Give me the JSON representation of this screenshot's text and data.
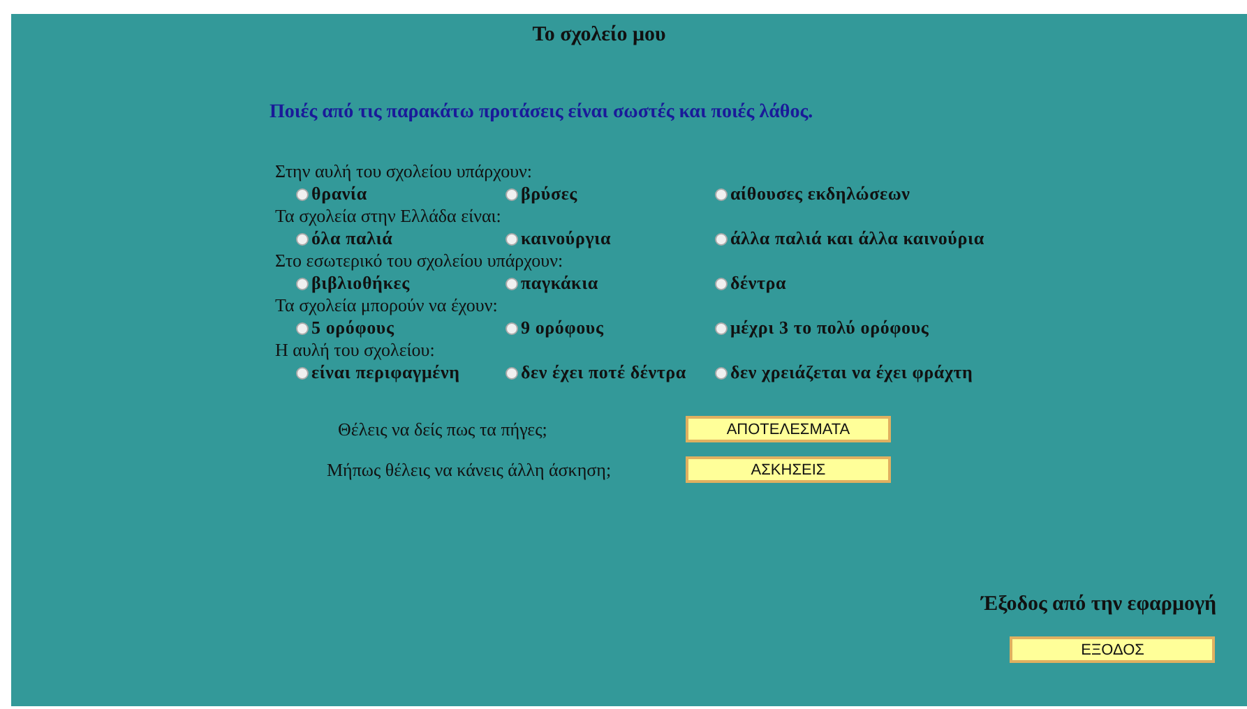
{
  "title": "Το σχολείο μου",
  "instruction": "Ποιές από τις παρακάτω προτάσεις είναι σωστές και ποιές λάθος.",
  "questions": [
    {
      "prompt": "Στην αυλή του σχολείου υπάρχουν:",
      "options": [
        {
          "label": "θρανία",
          "selected": false
        },
        {
          "label": "βρύσες",
          "selected": false
        },
        {
          "label": "αίθουσες εκδηλώσεων",
          "selected": false
        }
      ]
    },
    {
      "prompt": "Τα σχολεία στην Ελλάδα είναι:",
      "options": [
        {
          "label": "όλα παλιά",
          "selected": false
        },
        {
          "label": "καινούργια",
          "selected": false
        },
        {
          "label": "άλλα παλιά και άλλα καινούρια",
          "selected": false
        }
      ]
    },
    {
      "prompt": "Στο εσωτερικό του σχολείου υπάρχουν:",
      "options": [
        {
          "label": "βιβλιοθήκες",
          "selected": false
        },
        {
          "label": "παγκάκια",
          "selected": false
        },
        {
          "label": "δέντρα",
          "selected": false
        }
      ]
    },
    {
      "prompt": "Τα σχολεία μπορούν να έχουν:",
      "options": [
        {
          "label": "5 ορόφους",
          "selected": false
        },
        {
          "label": "9 ορόφους",
          "selected": false
        },
        {
          "label": "μέχρι 3 το πολύ ορόφους",
          "selected": false
        }
      ]
    },
    {
      "prompt": "Η αυλή του σχολείου:",
      "options": [
        {
          "label": "είναι περιφαγμένη",
          "selected": false
        },
        {
          "label": "δεν έχει ποτέ δέντρα",
          "selected": false
        },
        {
          "label": "δεν χρειάζεται να έχει φράχτη",
          "selected": false
        }
      ]
    }
  ],
  "actions": [
    {
      "prompt": "Θέλεις να δείς πως τα πήγες;",
      "button": "ΑΠΟΤΕΛΕΣΜΑΤΑ"
    },
    {
      "prompt": "Μήπως θέλεις να κάνεις άλλη άσκηση;",
      "button": "ΑΣΚΗΣΕΙΣ"
    }
  ],
  "exit": {
    "prompt": "Έξοδος από την εφαρμογή",
    "button": "ΕΞΟΔΟΣ"
  }
}
